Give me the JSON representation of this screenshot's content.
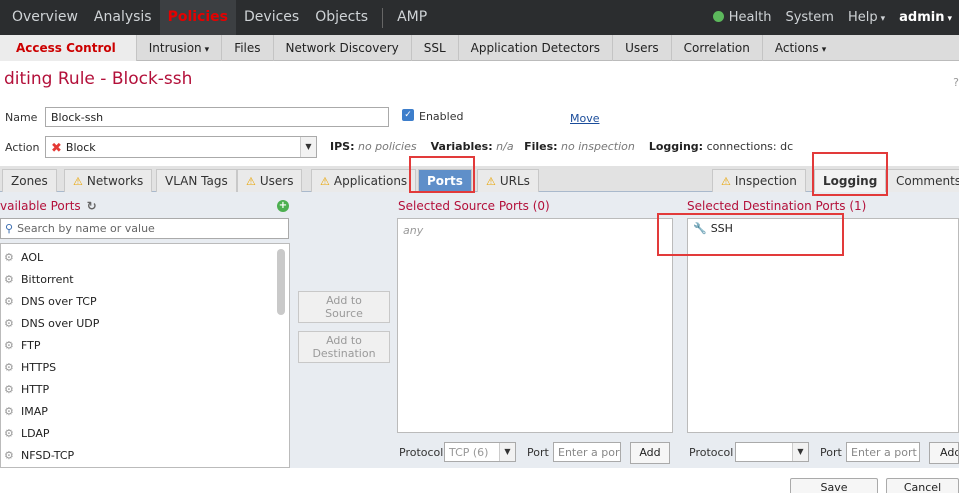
{
  "topnav": {
    "items": [
      "Overview",
      "Analysis",
      "Policies",
      "Devices",
      "Objects",
      "AMP"
    ],
    "right": {
      "health": "Health",
      "system": "System",
      "help": "Help",
      "admin": "admin"
    },
    "caret": "▾"
  },
  "subnav": {
    "items": [
      "Access Control",
      "Intrusion",
      "Files",
      "Network Discovery",
      "SSL",
      "Application Detectors",
      "Users",
      "Correlation",
      "Actions"
    ]
  },
  "page": {
    "title": "diting Rule - Block-ssh",
    "help_mark": "?"
  },
  "rule": {
    "name_label": "Name",
    "name_value": "Block-ssh",
    "enabled_label": "Enabled",
    "move_link": "Move",
    "action_label": "Action",
    "action_value": "Block",
    "ips_label": "IPS:",
    "ips_value": "no policies",
    "variables_label": "Variables:",
    "variables_value": "n/a",
    "files_label": "Files:",
    "files_value": "no inspection",
    "logging_label": "Logging:",
    "logging_value": "connections: dc"
  },
  "tabs": [
    "Zones",
    "Networks",
    "VLAN Tags",
    "Users",
    "Applications",
    "Ports",
    "URLs",
    "Inspection",
    "Logging",
    "Comments"
  ],
  "available": {
    "title": "vailable Ports",
    "search_placeholder": "Search by name or value",
    "ports": [
      "AOL",
      "Bittorrent",
      "DNS over TCP",
      "DNS over UDP",
      "FTP",
      "HTTPS",
      "HTTP",
      "IMAP",
      "LDAP",
      "NFSD-TCP"
    ]
  },
  "buttons": {
    "add_to_source": [
      "Add to",
      "Source"
    ],
    "add_to_destination": [
      "Add to",
      "Destination"
    ],
    "add": "Add",
    "save": "Save",
    "cancel": "Cancel"
  },
  "source": {
    "title": "Selected Source Ports (0)",
    "any": "any",
    "protocol_label": "Protocol",
    "protocol_value": "TCP (6)",
    "port_label": "Port",
    "port_placeholder": "Enter a port"
  },
  "destination": {
    "title": "Selected Destination Ports (1)",
    "item": "SSH",
    "protocol_label": "Protocol",
    "port_label": "Port",
    "port_placeholder": "Enter a port"
  },
  "colors": {
    "accent_red": "#b3103a",
    "active_tab": "#5f8fc9",
    "annotation": "#e23a3a"
  }
}
